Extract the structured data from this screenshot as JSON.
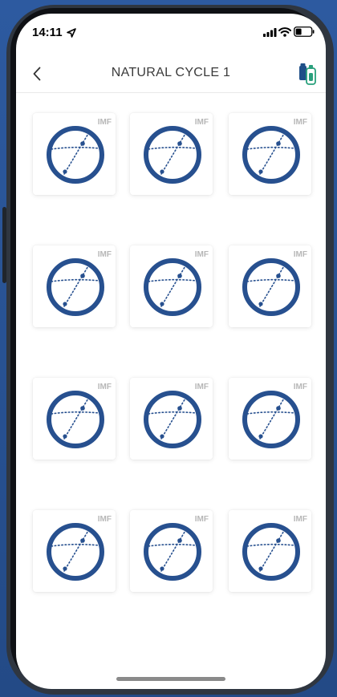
{
  "status_bar": {
    "time": "14:11",
    "icons": [
      "location-arrow-icon",
      "signal-icon",
      "wifi-icon",
      "battery-icon"
    ]
  },
  "nav": {
    "back_icon": "chevron-left-icon",
    "title": "NATURAL CYCLE 1",
    "right_icon": "medication-bottle-icon"
  },
  "grid": {
    "items": [
      {
        "label": "IMF"
      },
      {
        "label": "IMF"
      },
      {
        "label": "IMF"
      },
      {
        "label": "IMF"
      },
      {
        "label": "IMF"
      },
      {
        "label": "IMF"
      },
      {
        "label": "IMF"
      },
      {
        "label": "IMF"
      },
      {
        "label": "IMF"
      },
      {
        "label": "IMF"
      },
      {
        "label": "IMF"
      },
      {
        "label": "IMF"
      }
    ]
  },
  "colors": {
    "accent": "#27508f",
    "card_label": "#b7b7b7",
    "title": "#3a3a3a"
  }
}
